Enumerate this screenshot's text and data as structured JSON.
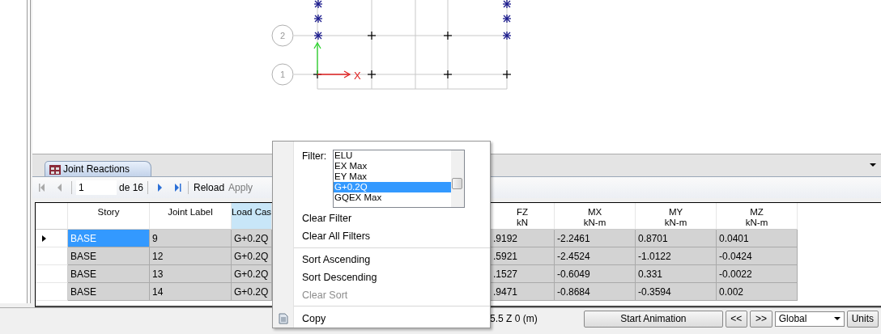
{
  "canvas": {
    "bubbles": [
      {
        "label": "2"
      },
      {
        "label": "1"
      }
    ],
    "axis_label": "X"
  },
  "panel": {
    "tabs": [
      {
        "label": "Joint Reactions",
        "selected": true
      }
    ],
    "toolbar": {
      "nav": [
        {
          "kind": "first",
          "disabled": true
        },
        {
          "kind": "prev",
          "disabled": true
        }
      ],
      "page": "1",
      "page_count": "de 16",
      "nav2": [
        {
          "kind": "next",
          "disabled": false
        },
        {
          "kind": "last",
          "disabled": false
        }
      ],
      "actions": [
        {
          "label": "Reload",
          "disabled": false
        },
        {
          "label": "Apply",
          "disabled": true
        }
      ]
    }
  },
  "table": {
    "columns": [
      {
        "name": "Story",
        "active": false
      },
      {
        "name": "Joint Label",
        "active": false
      },
      {
        "name": "Load Cas",
        "active": true
      },
      {
        "name": "FZ",
        "unit": "kN",
        "active": false
      },
      {
        "name": "MX",
        "unit": "kN-m",
        "active": false
      },
      {
        "name": "MY",
        "unit": "kN-m",
        "active": false
      },
      {
        "name": "MZ",
        "unit": "kN-m",
        "active": false
      }
    ],
    "rows": [
      {
        "selected": true,
        "cells": [
          "BASE",
          "9",
          "G+0.2Q",
          ".9192",
          "-2.2461",
          "0.8701",
          "0.0401"
        ]
      },
      {
        "selected": false,
        "cells": [
          "BASE",
          "12",
          "G+0.2Q",
          ".5921",
          "-2.4524",
          "-1.0122",
          "-0.0424"
        ]
      },
      {
        "selected": false,
        "cells": [
          "BASE",
          "13",
          "G+0.2Q",
          ".1527",
          "-0.6049",
          "0.331",
          "-0.0022"
        ]
      },
      {
        "selected": false,
        "cells": [
          "BASE",
          "14",
          "G+0.2Q",
          ".9471",
          "-0.8684",
          "-0.3594",
          "0.002"
        ]
      }
    ]
  },
  "context_menu": {
    "filter_label": "Filter:",
    "filter_options": [
      {
        "label": "ELU",
        "selected": false
      },
      {
        "label": "EX Max",
        "selected": false
      },
      {
        "label": "EY Max",
        "selected": false
      },
      {
        "label": "G+0.2Q",
        "selected": true
      },
      {
        "label": "GQEX Max",
        "selected": false
      }
    ],
    "items": [
      {
        "kind": "item",
        "label": "Clear Filter",
        "disabled": false
      },
      {
        "kind": "item",
        "label": "Clear All Filters",
        "disabled": false
      },
      {
        "kind": "separator"
      },
      {
        "kind": "item",
        "label": "Sort Ascending",
        "disabled": false
      },
      {
        "kind": "item",
        "label": "Sort Descending",
        "disabled": false
      },
      {
        "kind": "item",
        "label": "Clear Sort",
        "disabled": true
      },
      {
        "kind": "separator"
      },
      {
        "kind": "copy",
        "label": "Copy",
        "disabled": false
      }
    ]
  },
  "status_bar": {
    "coordinates": "5.5  Z 0 (m)",
    "animation_button": "Start Animation",
    "step_buttons": [
      "<<",
      ">>"
    ],
    "coordinate_system": "Global",
    "units_button": "Units"
  }
}
